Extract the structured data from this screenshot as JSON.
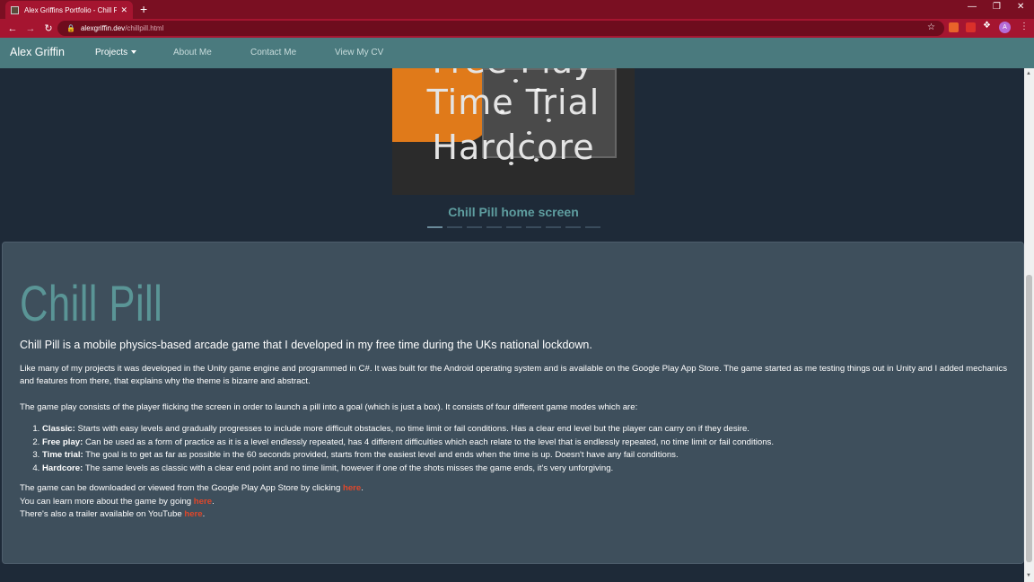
{
  "browser": {
    "tab_title": "Alex Griffins Portfolio - Chill Pill",
    "tab_close": "✕",
    "new_tab": "+",
    "url_domain": "alexgriffin.dev",
    "url_path": "/chillpill.html",
    "avatar_letter": "A"
  },
  "nav": {
    "brand": "Alex Griffin",
    "links": [
      "Projects",
      "About Me",
      "Contact Me",
      "View My CV"
    ]
  },
  "carousel": {
    "image_lines": [
      "Free Play",
      "Time Trial",
      "Hardcore"
    ],
    "caption": "Chill Pill home screen",
    "slide_count": 9,
    "active_slide": 1
  },
  "content": {
    "title": "Chill Pill",
    "lead": "Chill Pill is a mobile physics-based arcade game that I developed in my free time during the UKs national lockdown.",
    "para1": "Like many of my projects it was developed in the Unity game engine and programmed in C#. It was built for the Android operating system and is available on the Google Play App Store. The game started as me testing things out in Unity and I added mechanics and features from there, that explains why the theme is bizarre and abstract.",
    "para2": "The game play consists of the player flicking the screen in order to launch a pill into a goal (which is just a box). It consists of four different game modes which are:",
    "modes": [
      {
        "name": "Classic:",
        "desc": " Starts with easy levels and gradually progresses to include more difficult obstacles, no time limit or fail conditions. Has a clear end level but the player can carry on if they desire."
      },
      {
        "name": "Free play:",
        "desc": " Can be used as a form of practice as it is a level endlessly repeated, has 4 different difficulties which each relate to the level that is endlessly repeated, no time limit or fail conditions."
      },
      {
        "name": "Time trial:",
        "desc": " The goal is to get as far as possible in the 60 seconds provided, starts from the easiest level and ends when the time is up. Doesn't have any fail conditions."
      },
      {
        "name": "Hardcore:",
        "desc": " The same levels as classic with a clear end point and no time limit, however if one of the shots misses the game ends, it's very unforgiving."
      }
    ],
    "download_text": "The game can be downloaded or viewed from the Google Play App Store by clicking ",
    "learn_text": "You can learn more about the game by going ",
    "trailer_text": "There's also a trailer available on YouTube ",
    "link_label": "here",
    "period": "."
  }
}
